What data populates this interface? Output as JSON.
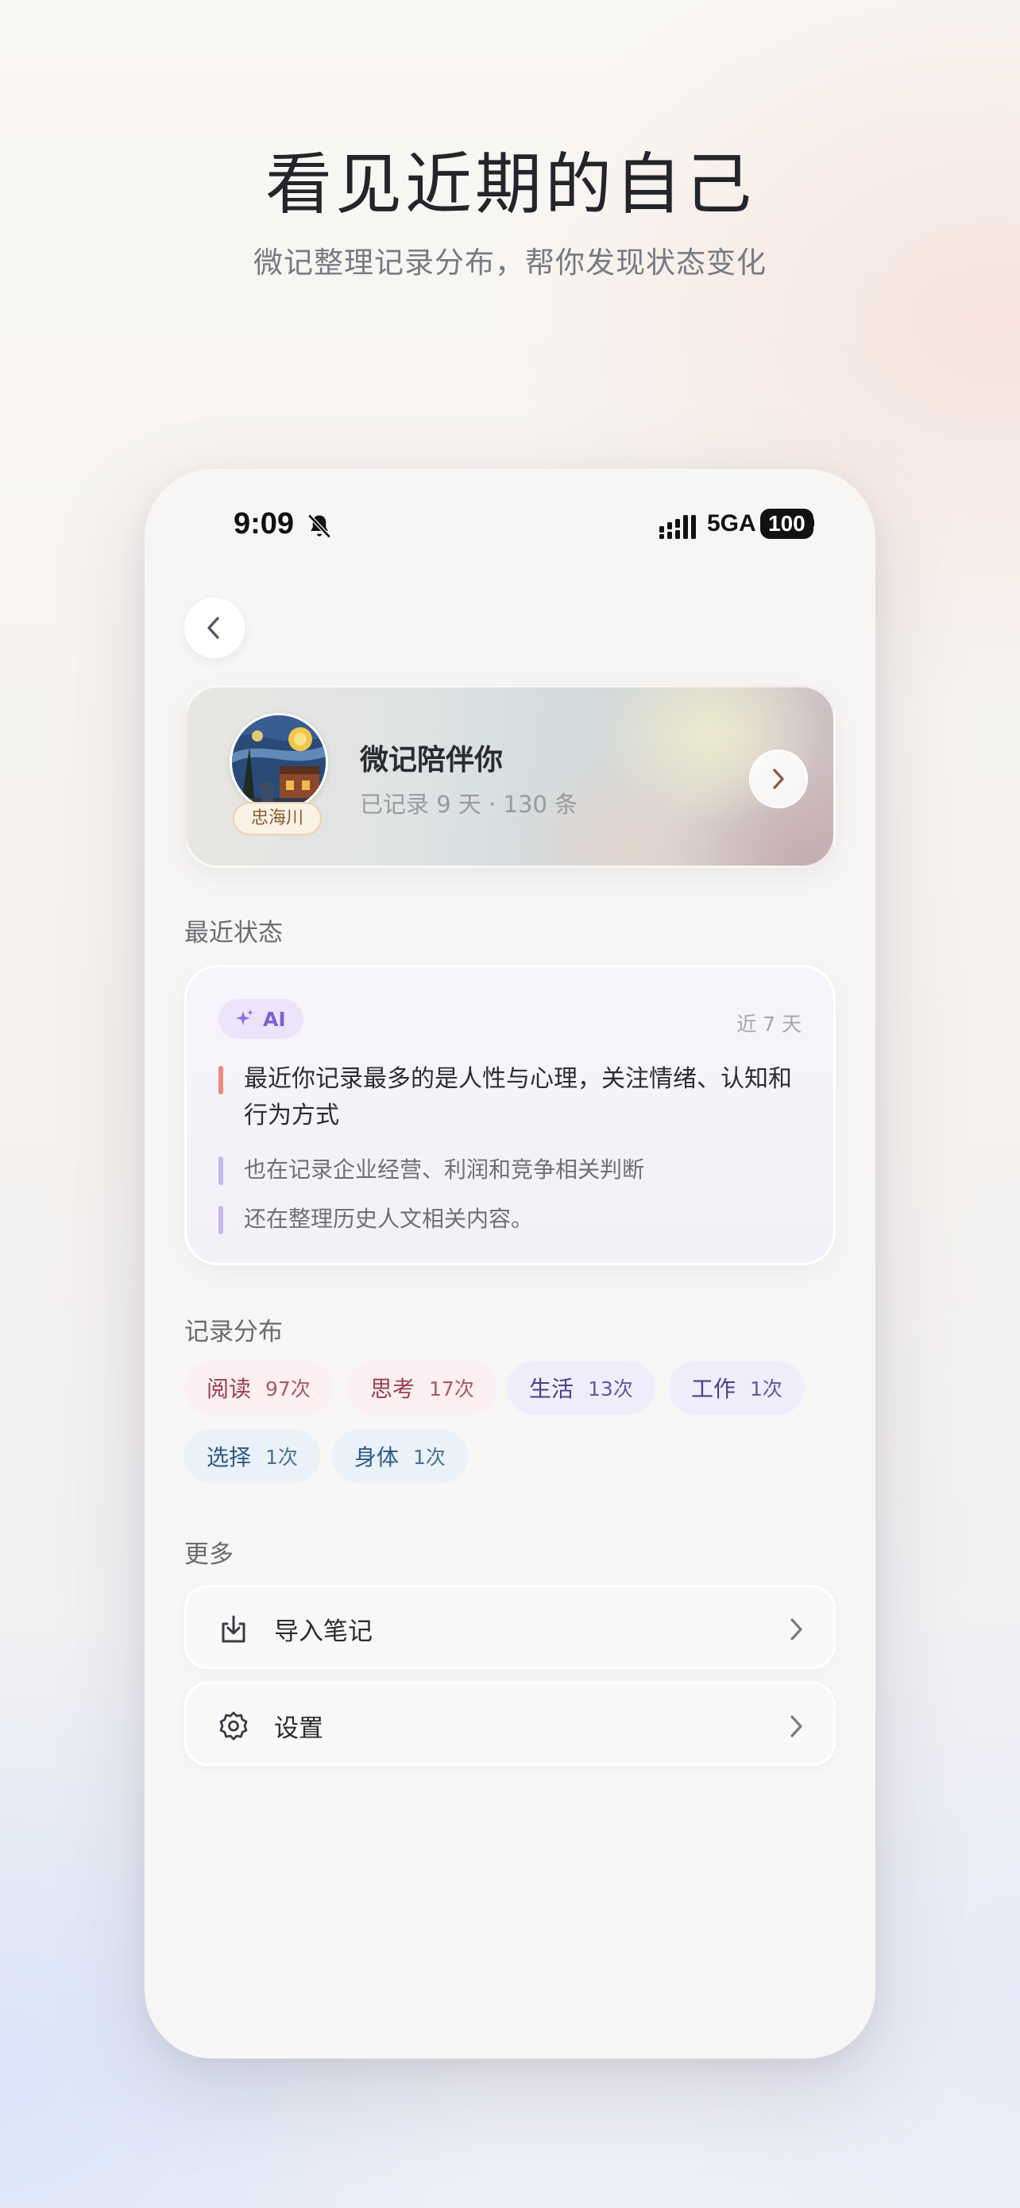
{
  "hero": {
    "title": "看见近期的自己",
    "subtitle": "微记整理记录分布，帮你发现状态变化"
  },
  "status_bar": {
    "time": "9:09",
    "network": "5GA",
    "battery": "100"
  },
  "profile": {
    "name": "微记陪伴你",
    "badge": "忠海川",
    "stats": "已记录 9 天 · 130 条"
  },
  "recent_status": {
    "section_title": "最近状态",
    "ai_label": "AI",
    "period": "近 7 天",
    "insights": [
      {
        "text": "最近你记录最多的是人性与心理，关注情绪、认知和行为方式",
        "bar_color": "#ef8b7c"
      },
      {
        "text": "也在记录企业经营、利润和竞争相关判断",
        "bar_color": "#c6b5f4"
      },
      {
        "text": "还在整理历史人文相关内容。",
        "bar_color": "#c6b5f4"
      }
    ]
  },
  "distribution": {
    "section_title": "记录分布",
    "tags": [
      {
        "name": "阅读",
        "count": "97次",
        "bg": "#fbeff1",
        "color": "#9a3f52"
      },
      {
        "name": "思考",
        "count": "17次",
        "bg": "#fbeff1",
        "color": "#9a3f52"
      },
      {
        "name": "生活",
        "count": "13次",
        "bg": "#efedfb",
        "color": "#4b3f8a"
      },
      {
        "name": "工作",
        "count": "1次",
        "bg": "#efedfb",
        "color": "#4b3f8a"
      },
      {
        "name": "选择",
        "count": "1次",
        "bg": "#eaf1f8",
        "color": "#2e5b86"
      },
      {
        "name": "身体",
        "count": "1次",
        "bg": "#eaf1f8",
        "color": "#2e5b86"
      }
    ]
  },
  "more": {
    "section_title": "更多",
    "items": [
      {
        "label": "导入笔记",
        "icon": "import-icon"
      },
      {
        "label": "设置",
        "icon": "gear-icon"
      }
    ]
  }
}
